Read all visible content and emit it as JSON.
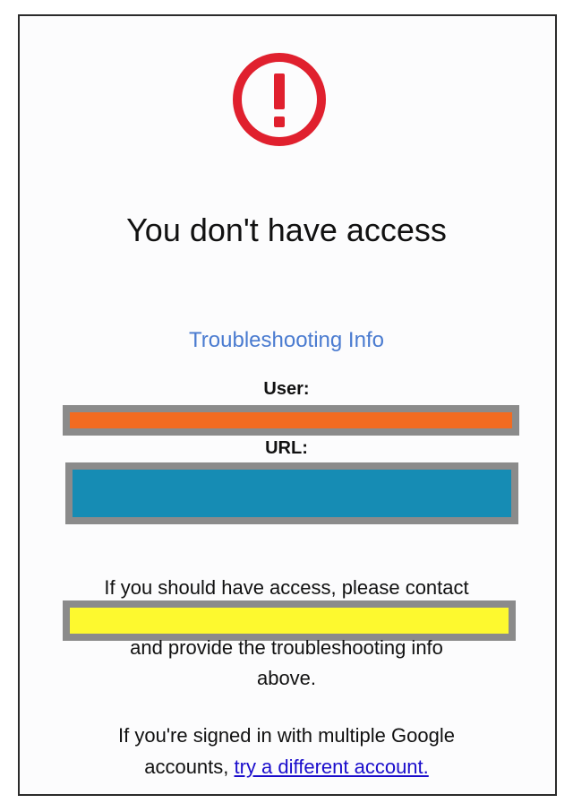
{
  "page": {
    "title": "You don't have access",
    "troubleshooting_header": "Troubleshooting Info",
    "user_label": "User:",
    "url_label": "URL:",
    "contact_line": "If you should have access, please contact",
    "provide_line": "and provide the troubleshooting info",
    "above_line": "above.",
    "multi_account_line": "If you're signed in with multiple Google",
    "accounts_prefix": "accounts, ",
    "switch_account_link": "try a different account."
  },
  "redactions": {
    "user_value_color": "#f26b21",
    "url_value_color": "#168cb4",
    "contact_value_color": "#fdf92f",
    "frame_color": "#8b8b8b"
  },
  "icons": {
    "alert": "exclamation-circle-icon",
    "alert_color": "#e0202e"
  }
}
